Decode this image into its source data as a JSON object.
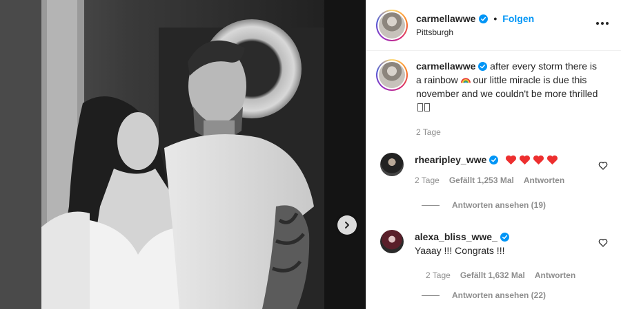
{
  "header": {
    "username": "carmellawwe",
    "separator": "•",
    "follow_label": "Folgen",
    "location": "Pittsburgh"
  },
  "caption": {
    "username": "carmellawwe",
    "text_before_emoji": "after every storm there is a rainbow",
    "emoji_icon": "rainbow-icon",
    "text_after_emoji": "our little miracle is due this november and we couldn't be more thrilled",
    "age": "2 Tage"
  },
  "comments": [
    {
      "username": "rhearipley_wwe",
      "text": "",
      "heart_count": 4,
      "age": "2 Tage",
      "likes": "Gefällt 1,253 Mal",
      "reply_label": "Antworten",
      "view_replies": "Antworten ansehen (19)"
    },
    {
      "username": "alexa_bliss_wwe_",
      "text": "Yaaay !!! Congrats !!!",
      "age": "2 Tage",
      "likes": "Gefällt 1,632 Mal",
      "reply_label": "Antworten",
      "view_replies": "Antworten ansehen (22)"
    }
  ],
  "colors": {
    "link_blue": "#0095f6",
    "verified_blue": "#0095f6",
    "muted": "#8e8e8e",
    "heart_red": "#ed2f2f"
  }
}
